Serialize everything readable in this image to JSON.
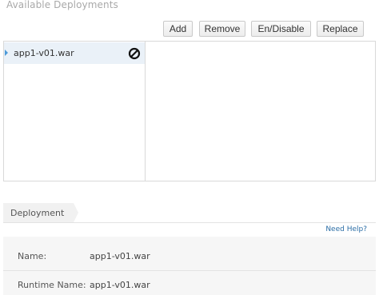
{
  "section_title": "Available Deployments",
  "toolbar": {
    "add_label": "Add",
    "remove_label": "Remove",
    "endisable_label": "En/Disable",
    "replace_label": "Replace"
  },
  "deployments": [
    {
      "name": "app1-v01.war",
      "status_icon": "disabled-icon",
      "selected": true
    }
  ],
  "tabs": [
    {
      "label": "Deployment"
    }
  ],
  "help_link": "Need Help?",
  "details": [
    {
      "label": "Name:",
      "value": "app1-v01.war"
    },
    {
      "label": "Runtime Name:",
      "value": "app1-v01.war"
    }
  ],
  "colors": {
    "accent": "#4c9ad8",
    "selection": "#eaf1f8",
    "link": "#2c6ea6"
  }
}
